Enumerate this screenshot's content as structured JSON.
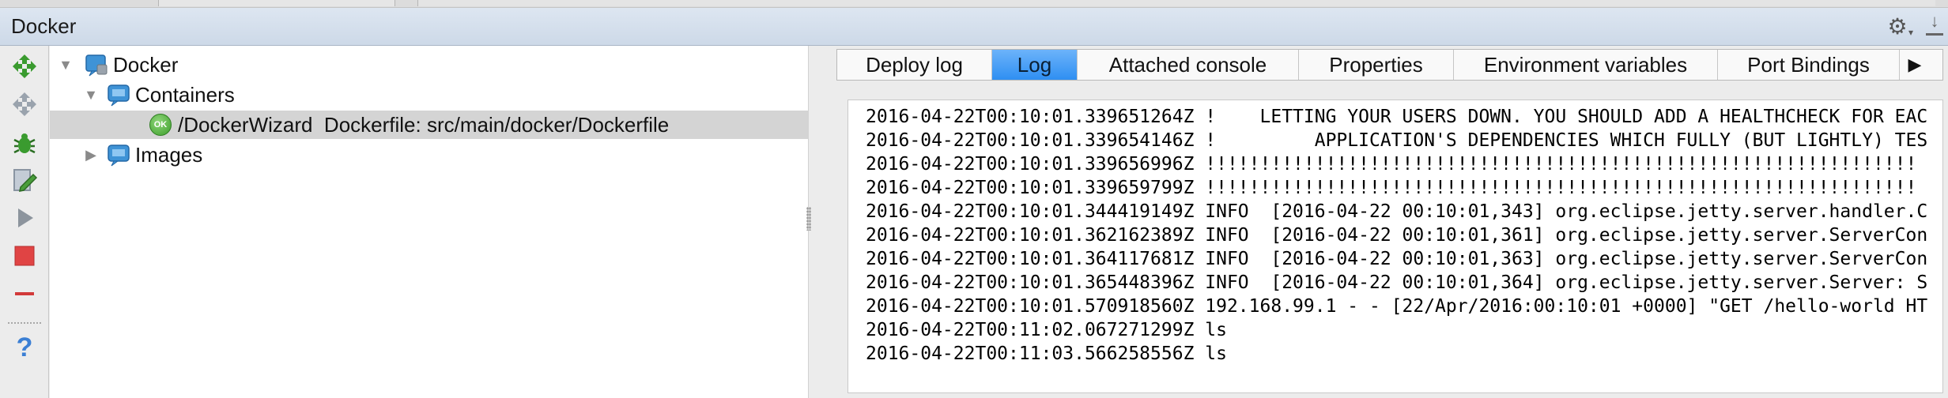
{
  "tool_window": {
    "title": "Docker"
  },
  "toolbar": {
    "icons": [
      "deploy-icon",
      "redeploy-icon",
      "debug-icon",
      "edit-configuration-icon",
      "start-icon",
      "stop-icon",
      "delete-icon",
      "help-icon"
    ],
    "help_label": "?"
  },
  "tree": {
    "root": {
      "label": "Docker",
      "icon": "docker-server-icon",
      "expanded": true
    },
    "containers": {
      "label": "Containers",
      "icon": "docker-node-icon",
      "expanded": true
    },
    "container_item": {
      "status_icon": "ok-status-icon",
      "status_text": "OK",
      "label": "/DockerWizard  Dockerfile: src/main/docker/Dockerfile"
    },
    "images": {
      "label": "Images",
      "icon": "docker-node-icon",
      "expanded": false
    }
  },
  "tabs": [
    {
      "label": "Deploy log",
      "active": false
    },
    {
      "label": "Log",
      "active": true
    },
    {
      "label": "Attached console",
      "active": false
    },
    {
      "label": "Properties",
      "active": false
    },
    {
      "label": "Environment variables",
      "active": false
    },
    {
      "label": "Port Bindings",
      "active": false
    }
  ],
  "tabs_more": "▶",
  "log": {
    "lines": [
      "2016-04-22T00:10:01.339651264Z !    LETTING YOUR USERS DOWN. YOU SHOULD ADD A HEALTHCHECK FOR EAC",
      "2016-04-22T00:10:01.339654146Z !         APPLICATION'S DEPENDENCIES WHICH FULLY (BUT LIGHTLY) TES",
      "2016-04-22T00:10:01.339656996Z !!!!!!!!!!!!!!!!!!!!!!!!!!!!!!!!!!!!!!!!!!!!!!!!!!!!!!!!!!!!!!!!!",
      "2016-04-22T00:10:01.339659799Z !!!!!!!!!!!!!!!!!!!!!!!!!!!!!!!!!!!!!!!!!!!!!!!!!!!!!!!!!!!!!!!!!",
      "2016-04-22T00:10:01.344419149Z INFO  [2016-04-22 00:10:01,343] org.eclipse.jetty.server.handler.C",
      "2016-04-22T00:10:01.362162389Z INFO  [2016-04-22 00:10:01,361] org.eclipse.jetty.server.ServerCon",
      "2016-04-22T00:10:01.364117681Z INFO  [2016-04-22 00:10:01,363] org.eclipse.jetty.server.ServerCon",
      "2016-04-22T00:10:01.365448396Z INFO  [2016-04-22 00:10:01,364] org.eclipse.jetty.server.Server: S",
      "2016-04-22T00:10:01.570918560Z 192.168.99.1 - - [22/Apr/2016:00:10:01 +0000] \"GET /hello-world HT",
      "2016-04-22T00:11:02.067271299Z ls",
      "2016-04-22T00:11:03.566258556Z ls"
    ]
  },
  "colors": {
    "header_bg": "#d5dfec",
    "active_tab": "#3d96f5",
    "selected_row": "#d4d4d4",
    "deploy_green": "#3a9b2f",
    "stop_red": "#e04444"
  }
}
